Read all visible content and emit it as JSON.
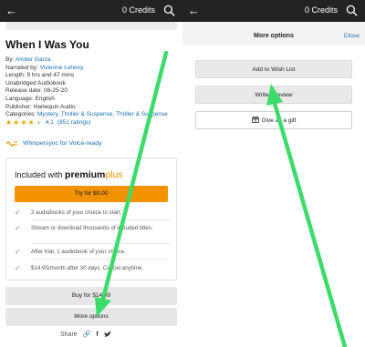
{
  "left": {
    "topbar": {
      "credits": "0 Credits",
      "back_icon": "arrow-left-icon",
      "search_icon": "search-icon"
    },
    "book": {
      "title": "When I Was You",
      "by_label": "By: ",
      "author": "Amber Garza",
      "narrated_label": "Narrated by: ",
      "narrator": "Vivienne Leheny",
      "length": "Length: 9 hrs and 47 mins",
      "format": "Unabridged Audiobook",
      "release": "Release date: 08-25-20",
      "language": "Language: English",
      "publisher": "Publisher: Harlequin Audio",
      "categories_label": "Categories: ",
      "categories": "Mystery, Thriller & Suspense, Thriller & Suspense",
      "rating_value": "4.1",
      "rating_count": "(851 ratings)",
      "rating_stars": 4.1,
      "whispersync": "Whispersync for Voice-ready"
    },
    "plus": {
      "included": "Included with ",
      "brand": "premium",
      "brand_plus": "plus",
      "try_label": "Try for $0.00",
      "benefits": [
        "2 audiobooks of your choice to start.",
        "Stream or download thousands of included titles.",
        "After trial, 1 audiobook of your choice.",
        "$14.95/month after 30 days. Cancel anytime."
      ]
    },
    "buy_label": "Buy for $14.99",
    "more_options_label": "More options",
    "share_label": "Share"
  },
  "right": {
    "topbar": {
      "credits": "0 Credits",
      "back_icon": "arrow-left-icon",
      "search_icon": "search-icon"
    },
    "title": "More options",
    "close_label": "Close",
    "buttons": {
      "wishlist": "Add to Wish List",
      "review": "Write a review",
      "gift": "Give as a gift"
    }
  },
  "colors": {
    "topbar": "#232323",
    "accent_orange": "#f39200",
    "link_blue": "#1a6fb0",
    "arrow_green": "#3ddc6a"
  }
}
